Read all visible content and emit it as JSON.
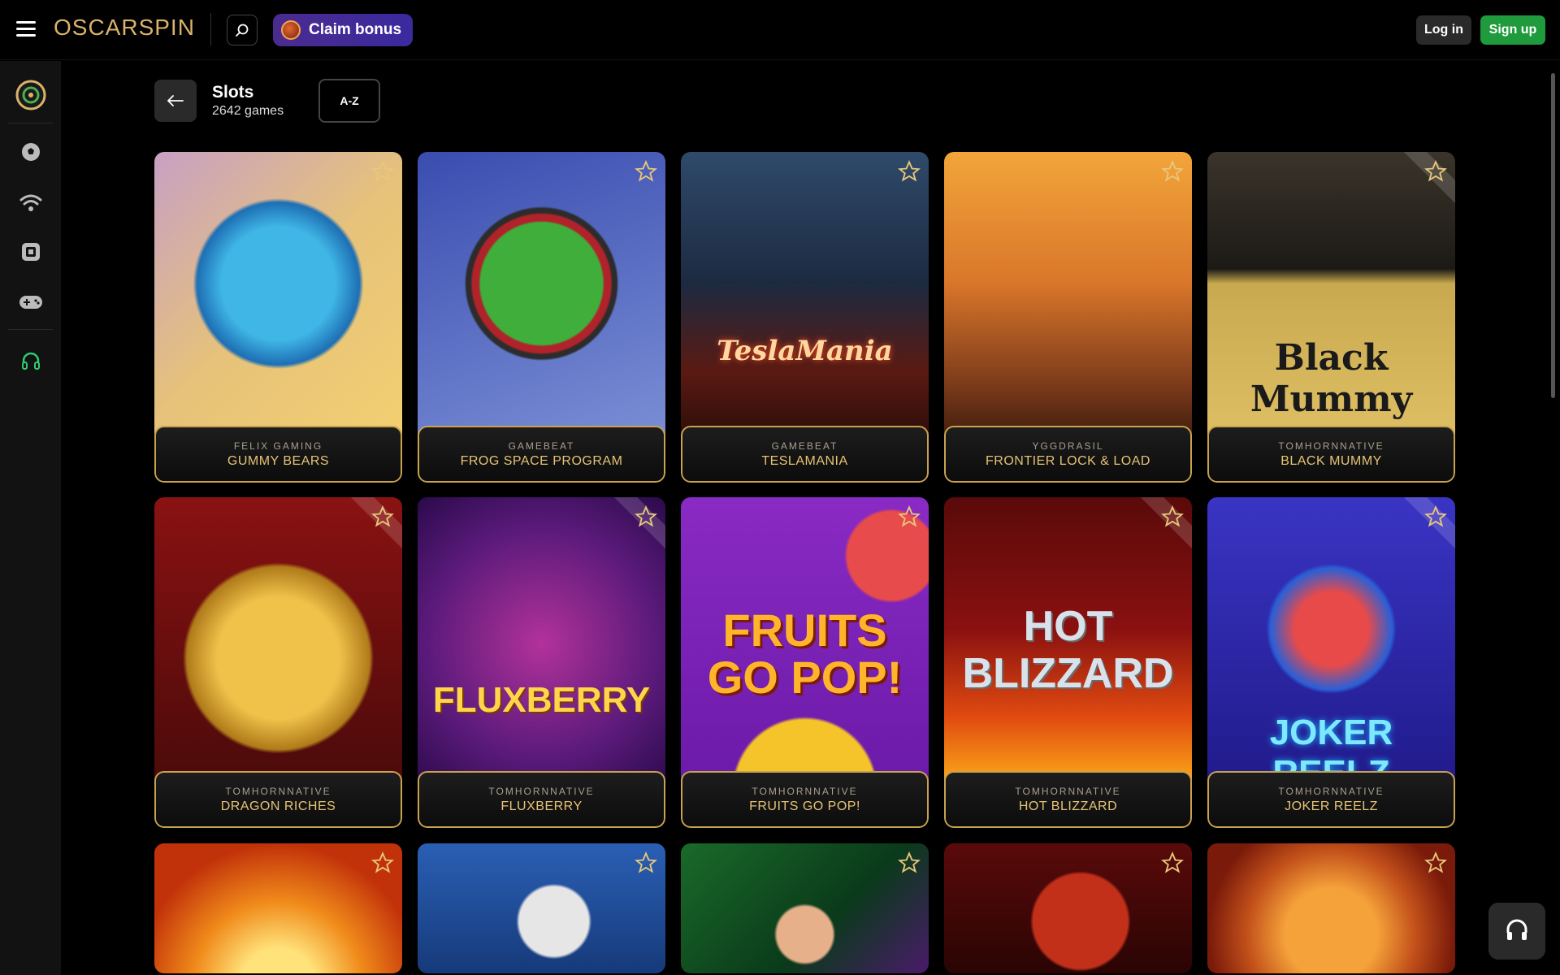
{
  "header": {
    "logo_text": "OSCARSPIN",
    "claim_bonus_label": "Claim bonus",
    "login_label": "Log in",
    "signup_label": "Sign up",
    "search_icon": "search-icon",
    "menu_icon": "menu-icon"
  },
  "sidebar": {
    "items": [
      {
        "icon": "oscar-logo-icon"
      },
      {
        "icon": "sports-ball-icon"
      },
      {
        "icon": "live-signal-icon"
      },
      {
        "icon": "casino-chip-icon"
      },
      {
        "icon": "gamepad-icon"
      },
      {
        "icon": "support-headset-icon"
      }
    ]
  },
  "category": {
    "title": "Slots",
    "count": "2642 games",
    "sort_label": "A-Z"
  },
  "games": [
    {
      "provider": "FELIX GAMING",
      "name": "GUMMY BEARS"
    },
    {
      "provider": "GAMEBEAT",
      "name": "FROG SPACE PROGRAM"
    },
    {
      "provider": "GAMEBEAT",
      "name": "TESLAMANIA"
    },
    {
      "provider": "YGGDRASIL",
      "name": "FRONTIER LOCK & LOAD"
    },
    {
      "provider": "TOMHORNNATIVE",
      "name": "BLACK MUMMY"
    },
    {
      "provider": "TOMHORNNATIVE",
      "name": "DRAGON RICHES"
    },
    {
      "provider": "TOMHORNNATIVE",
      "name": "FLUXBERRY"
    },
    {
      "provider": "TOMHORNNATIVE",
      "name": "FRUITS GO POP!"
    },
    {
      "provider": "TOMHORNNATIVE",
      "name": "HOT BLIZZARD"
    },
    {
      "provider": "TOMHORNNATIVE",
      "name": "JOKER REELZ"
    }
  ],
  "art_text": {
    "tesla": "TeslaMania",
    "mummy": "Black Mummy",
    "flux": "FLUXBERRY",
    "fruits": "FRUITS GO POP!",
    "hot": "HOT BLIZZARD",
    "joker": "JOKER REELZ"
  },
  "colors": {
    "accent_gold": "#c9a24f",
    "signup_green": "#1f9a3c",
    "claim_purple": "#4b2b8f"
  }
}
